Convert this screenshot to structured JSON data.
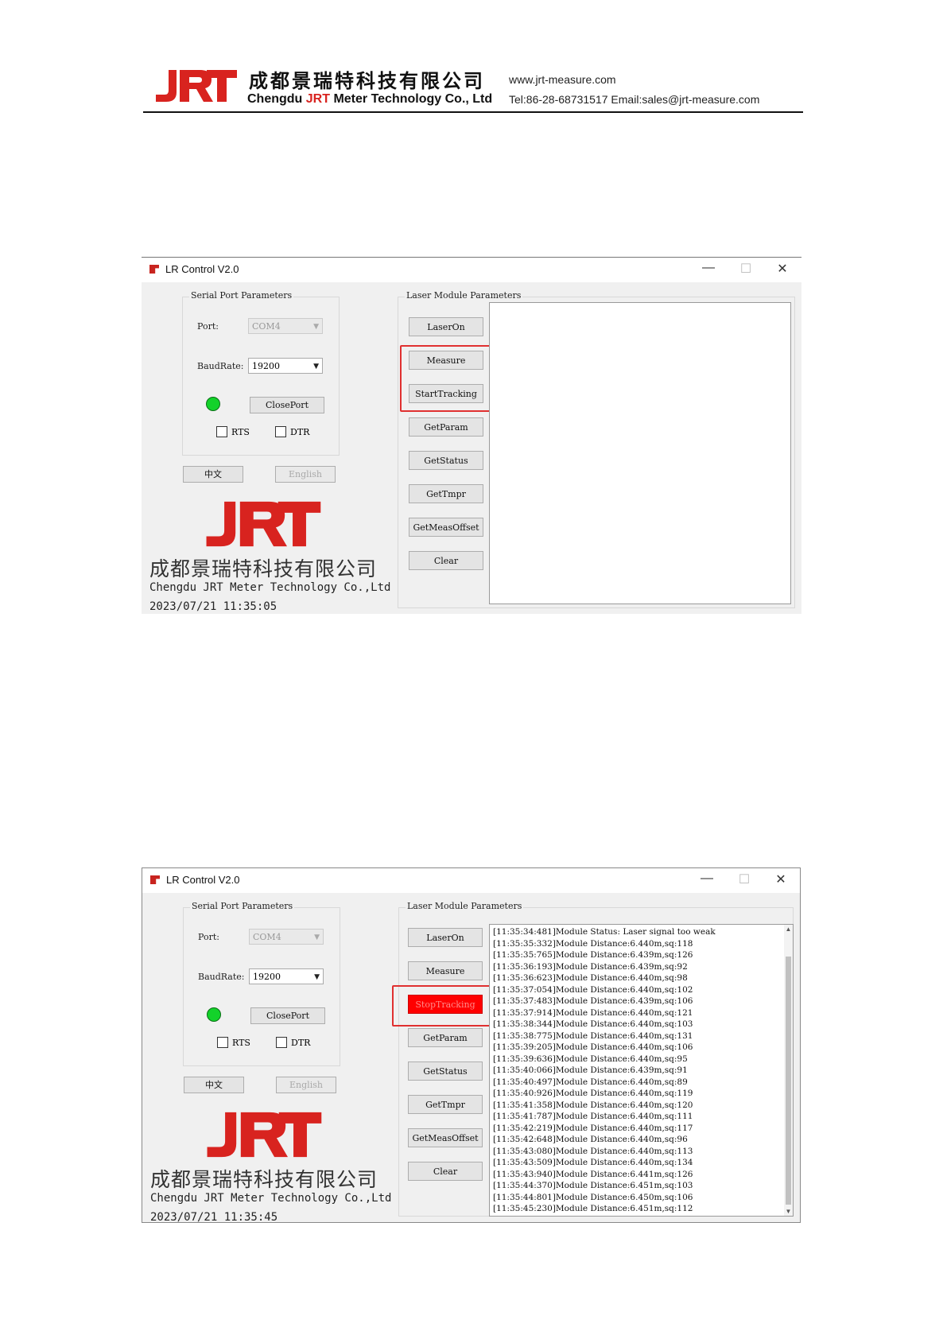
{
  "doc_header": {
    "company_cn": "成都景瑞特科技有限公司",
    "company_en_prefix": "Chengdu ",
    "company_en_brand": "JRT",
    "company_en_suffix": " Meter Technology Co., Ltd",
    "website": "www.jrt-measure.com",
    "contact": "Tel:86-28-68731517  Email:sales@jrt-measure.com",
    "logo_text": "JRT"
  },
  "accent_colors": {
    "brand_red": "#d8231f",
    "highlight_red": "#e03030",
    "led_green": "#13d22a"
  },
  "windows": [
    {
      "title": "LR Control V2.0",
      "window_controls": {
        "minimize": "—",
        "maximize": "☐",
        "close": "✕"
      },
      "serial_group_title": "Serial Port Parameters",
      "port_label": "Port:",
      "port_value": "COM4",
      "baud_label": "BaudRate:",
      "baud_value": "19200",
      "close_port": "ClosePort",
      "rts": "RTS",
      "dtr": "DTR",
      "lang_cn": "中文",
      "lang_en": "English",
      "laser_group_title": "Laser Module Parameters",
      "buttons": [
        "LaserOn",
        "Measure",
        "StartTracking",
        "GetParam",
        "GetStatus",
        "GetTmpr",
        "GetMeasOffset",
        "Clear"
      ],
      "brand_cn": "成都景瑞特科技有限公司",
      "brand_en": "Chengdu JRT Meter Technology Co.,Ltd",
      "timestamp": "2023/07/21 11:35:05",
      "log_lines": []
    },
    {
      "title": "LR Control V2.0",
      "window_controls": {
        "minimize": "—",
        "maximize": "☐",
        "close": "✕"
      },
      "serial_group_title": "Serial Port Parameters",
      "port_label": "Port:",
      "port_value": "COM4",
      "baud_label": "BaudRate:",
      "baud_value": "19200",
      "close_port": "ClosePort",
      "rts": "RTS",
      "dtr": "DTR",
      "lang_cn": "中文",
      "lang_en": "English",
      "laser_group_title": "Laser Module Parameters",
      "buttons": [
        "LaserOn",
        "Measure",
        "StopTracking",
        "GetParam",
        "GetStatus",
        "GetTmpr",
        "GetMeasOffset",
        "Clear"
      ],
      "brand_cn": "成都景瑞特科技有限公司",
      "brand_en": "Chengdu JRT Meter Technology Co.,Ltd",
      "timestamp": "2023/07/21 11:35:45",
      "log_lines": [
        "[11:35:34:481]Module Status: Laser signal too weak",
        "[11:35:35:332]Module Distance:6.440m,sq:118",
        "[11:35:35:765]Module Distance:6.439m,sq:126",
        "[11:35:36:193]Module Distance:6.439m,sq:92",
        "[11:35:36:623]Module Distance:6.440m,sq:98",
        "[11:35:37:054]Module Distance:6.440m,sq:102",
        "[11:35:37:483]Module Distance:6.439m,sq:106",
        "[11:35:37:914]Module Distance:6.440m,sq:121",
        "[11:35:38:344]Module Distance:6.440m,sq:103",
        "[11:35:38:775]Module Distance:6.440m,sq:131",
        "[11:35:39:205]Module Distance:6.440m,sq:106",
        "[11:35:39:636]Module Distance:6.440m,sq:95",
        "[11:35:40:066]Module Distance:6.439m,sq:91",
        "[11:35:40:497]Module Distance:6.440m,sq:89",
        "[11:35:40:926]Module Distance:6.440m,sq:119",
        "[11:35:41:358]Module Distance:6.440m,sq:120",
        "[11:35:41:787]Module Distance:6.440m,sq:111",
        "[11:35:42:219]Module Distance:6.440m,sq:117",
        "[11:35:42:648]Module Distance:6.440m,sq:96",
        "[11:35:43:080]Module Distance:6.440m,sq:113",
        "[11:35:43:509]Module Distance:6.440m,sq:134",
        "[11:35:43:940]Module Distance:6.441m,sq:126",
        "[11:35:44:370]Module Distance:6.451m,sq:103",
        "[11:35:44:801]Module Distance:6.450m,sq:106",
        "[11:35:45:230]Module Distance:6.451m,sq:112"
      ]
    }
  ]
}
